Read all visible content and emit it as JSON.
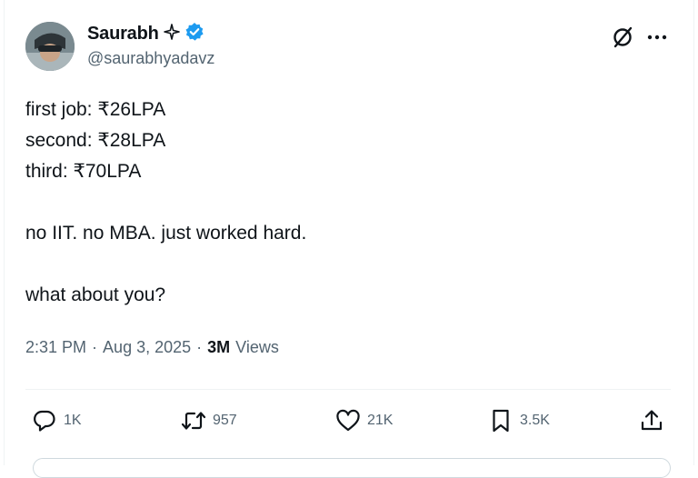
{
  "author": {
    "display_name": "Saurabh",
    "handle": "@saurabhyadavz",
    "verified": true
  },
  "tweet": {
    "text": "first job: ₹26LPA\nsecond: ₹28LPA\nthird: ₹70LPA\n\nno IIT. no MBA. just worked hard.\n\nwhat about you?"
  },
  "meta": {
    "time": "2:31 PM",
    "date": "Aug 3, 2025",
    "views_count": "3M",
    "views_label": "Views",
    "separator": "·"
  },
  "actions": {
    "replies": "1K",
    "reposts": "957",
    "likes": "21K",
    "bookmarks": "3.5K"
  },
  "colors": {
    "text": "#0f1419",
    "secondary": "#536471",
    "verified_badge": "#1d9bf0"
  },
  "icons": [
    "sparkle-icon",
    "verified-badge-icon",
    "grok-icon",
    "more-icon",
    "reply-icon",
    "repost-icon",
    "like-icon",
    "bookmark-icon",
    "share-icon"
  ]
}
